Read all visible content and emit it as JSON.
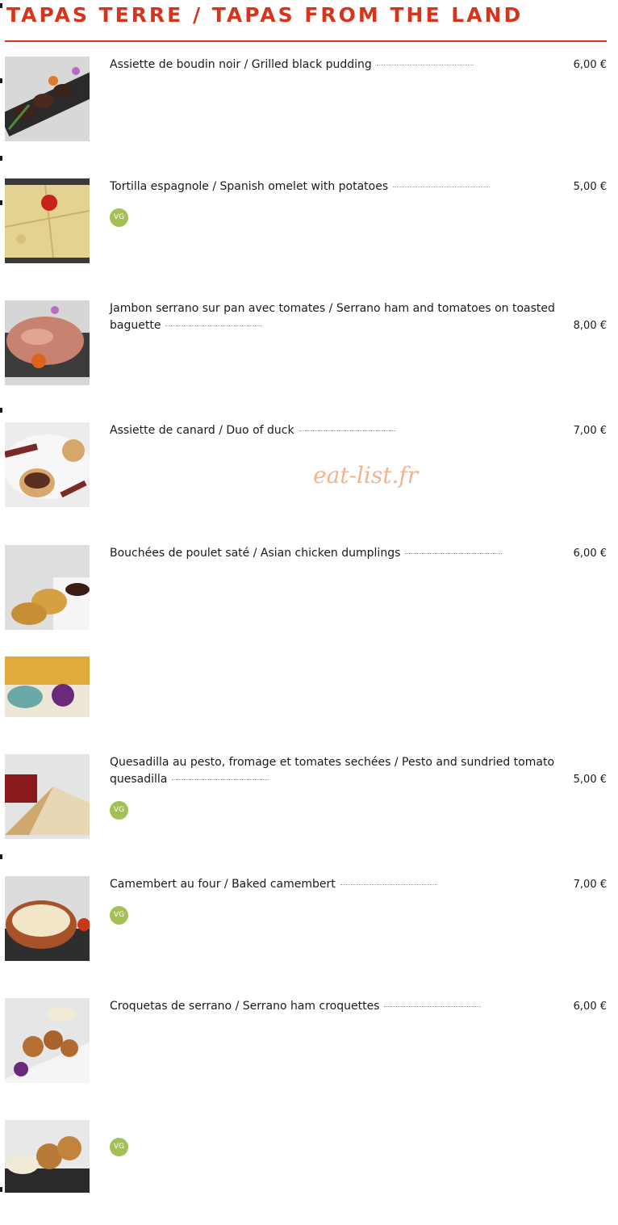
{
  "section_title": "TAPAS TERRE / TAPAS FROM THE LAND",
  "watermark": "eat-list.fr",
  "items": [
    {
      "name": "Assiette de boudin noir / Grilled black pudding",
      "price": "6,00 €",
      "vg": "",
      "image": "black-pudding-plate-image"
    },
    {
      "name": "Tortilla espagnole / Spanish omelet with potatoes",
      "price": "5,00 €",
      "vg": "VG",
      "image": "tortilla-image"
    },
    {
      "name": "Jambon serrano sur pan avec tomates / Serrano ham and tomatoes on toasted baguette",
      "price": "8,00 €",
      "vg": "",
      "image": "serrano-ham-image"
    },
    {
      "name": "Assiette de canard / Duo of duck",
      "price": "7,00 €",
      "vg": "",
      "image": "duck-plate-image"
    },
    {
      "name": "Bouchées de poulet saté / Asian chicken dumplings",
      "price": "6,00 €",
      "vg": "",
      "image": "chicken-dumplings-image"
    },
    {
      "name": "",
      "price": "",
      "vg": "",
      "image": "fried-tapas-image"
    },
    {
      "name": "Quesadilla au pesto, fromage et tomates sechées / Pesto and sundried tomato quesadilla",
      "price": "5,00 €",
      "vg": "VG",
      "image": "quesadilla-image"
    },
    {
      "name": "Camembert au four / Baked camembert",
      "price": "7,00 €",
      "vg": "VG",
      "image": "baked-camembert-image"
    },
    {
      "name": "Croquetas de serrano / Serrano ham croquettes",
      "price": "6,00 €",
      "vg": "",
      "image": "croquettes-image"
    },
    {
      "name": "",
      "price": "",
      "vg": "VG",
      "image": "fritters-image"
    }
  ]
}
